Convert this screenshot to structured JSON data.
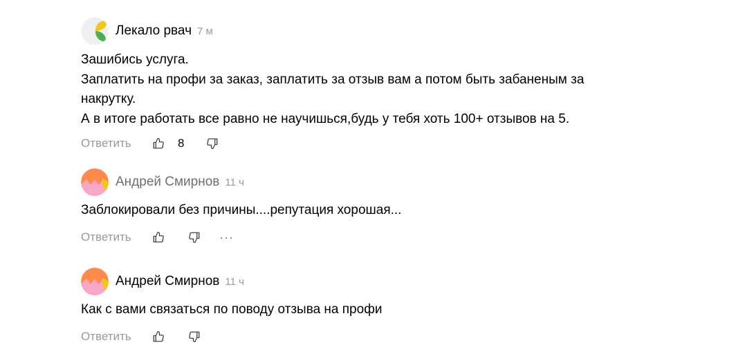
{
  "comments": [
    {
      "author": "Лекало рвач",
      "time": "7 м",
      "lines": [
        "Зашибись услуга.",
        "Заплатить на профи за заказ, заплатить за отзыв вам а потом быть забаненым за",
        "накрутку.",
        "А в итоге работать все равно не научишься,будь у тебя хоть 100+ отзывов на 5."
      ],
      "reply_label": "Ответить",
      "likes": "8"
    },
    {
      "author": "Андрей Смирнов",
      "time": "11 ч",
      "lines": [
        "Заблокировали без причины....репутация хорошая..."
      ],
      "reply_label": "Ответить",
      "more": "···"
    },
    {
      "author": "Андрей Смирнов",
      "time": "11 ч",
      "lines": [
        "Как с вами связаться по поводу отзыва на профи"
      ],
      "reply_label": "Ответить"
    }
  ],
  "icons": {
    "like": "thumb-up-icon",
    "dislike": "thumb-down-icon",
    "more": "more-dots-icon"
  },
  "colors": {
    "muted_text": "#999999",
    "avatar_leaf_yellow": "#F5C518",
    "avatar_leaf_green": "#4CAF50",
    "avatar_orange": "#FF8A4C",
    "avatar_pink": "#F7A8C8"
  }
}
